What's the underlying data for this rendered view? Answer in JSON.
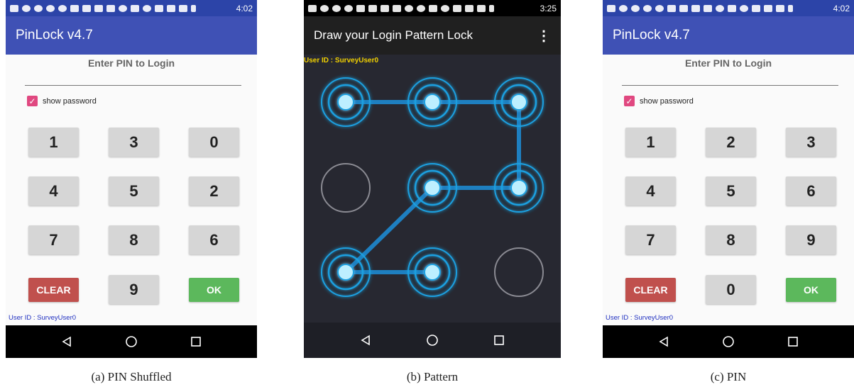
{
  "panels": {
    "a": {
      "time": "4:02",
      "app_title": "PinLock v4.7",
      "prompt": "Enter PIN to Login",
      "show_password_label": "show password",
      "show_password_checked": true,
      "keys": [
        "1",
        "3",
        "0",
        "4",
        "5",
        "2",
        "7",
        "8",
        "6",
        "CLEAR",
        "9",
        "OK"
      ],
      "user_id": "User ID : SurveyUser0",
      "caption": "(a) PIN Shuffled"
    },
    "b": {
      "time": "3:25",
      "app_title": "Draw your Login Pattern Lock",
      "menu_icon": "overflow-menu-icon",
      "user_id": "User ID : SurveyUser0",
      "grid": "3x3",
      "pattern_path": [
        1,
        2,
        3,
        6,
        5,
        7,
        8
      ],
      "unselected_nodes": [
        4,
        9
      ],
      "caption": "(b) Pattern"
    },
    "c": {
      "time": "4:02",
      "app_title": "PinLock v4.7",
      "prompt": "Enter PIN to Login",
      "show_password_label": "show password",
      "show_password_checked": true,
      "keys": [
        "1",
        "2",
        "3",
        "4",
        "5",
        "6",
        "7",
        "8",
        "9",
        "CLEAR",
        "0",
        "OK"
      ],
      "user_id": "User ID : SurveyUser0",
      "caption": "(c) PIN"
    }
  },
  "colors": {
    "pin_appbar": "#3f51b5",
    "pin_statusbar": "#2c44a8",
    "checkbox": "#e04880",
    "clear_key": "#c0504d",
    "ok_key": "#5cb85c",
    "pattern_bg": "#272831",
    "pattern_line": "#1e7fc0",
    "pattern_node": "#bdefff",
    "user_id_pin": "#2030c0",
    "user_id_pattern": "#f0d000"
  },
  "nav_icons": [
    "back-icon",
    "home-icon",
    "recents-icon"
  ]
}
